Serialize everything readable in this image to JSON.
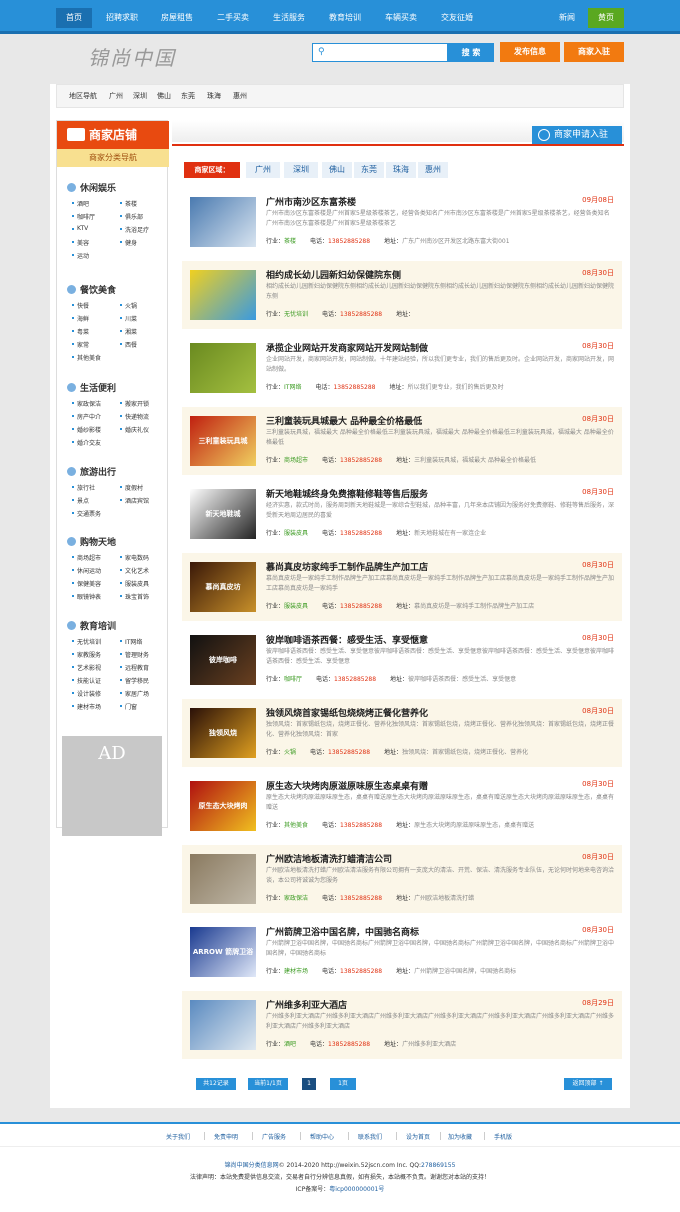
{
  "nav": {
    "items": [
      "首页",
      "招聘求职",
      "房屋租售",
      "二手买卖",
      "生活服务",
      "教育培训",
      "车辆买卖",
      "交友征婚"
    ],
    "right": [
      "新闻",
      "黄页"
    ]
  },
  "header": {
    "logo": "锦尚中国",
    "search_placeholder": "",
    "search_btn": "搜 索",
    "publish": "发布信息",
    "merchant_join": "商家入驻"
  },
  "region_nav": {
    "label": "地区导航",
    "cities": [
      "广州",
      "深圳",
      "佛山",
      "东莞",
      "珠海",
      "惠州"
    ]
  },
  "sidebar": {
    "title": "商家店铺",
    "subtitle": "商家分类导航",
    "ad": "AD",
    "cats": [
      {
        "name": "休闲娱乐",
        "subs": [
          "酒吧",
          "茶楼",
          "咖啡厅",
          "俱乐部",
          "KTV",
          "洗浴足疗",
          "美容",
          "健身",
          "运动"
        ]
      },
      {
        "name": "餐饮美食",
        "subs": [
          "快餐",
          "火锅",
          "海鲜",
          "川菜",
          "粤菜",
          "湘菜",
          "家常",
          "西餐",
          "其他美食"
        ]
      },
      {
        "name": "生活便利",
        "subs": [
          "家政保洁",
          "搬家开锁",
          "房产中介",
          "快递物流",
          "婚纱影楼",
          "婚庆礼仪",
          "婚介交友"
        ]
      },
      {
        "name": "旅游出行",
        "subs": [
          "旅行社",
          "度假村",
          "景点",
          "酒店宾馆",
          "交通票务"
        ]
      },
      {
        "name": "购物天地",
        "subs": [
          "商场超市",
          "家电数码",
          "休闲运动",
          "文化艺术",
          "保健美容",
          "服装皮具",
          "眼镜钟表",
          "珠宝首饰"
        ]
      },
      {
        "name": "教育培训",
        "subs": [
          "无忧培训",
          "IT网络",
          "家教服务",
          "管理财务",
          "艺术影视",
          "远程教育",
          "技能认证",
          "留学移民",
          "设计装修",
          "家居广场",
          "建材市场",
          "门窗"
        ]
      }
    ]
  },
  "content": {
    "apply": "商家申请入驻",
    "area_label": "商家区域：",
    "tabs": [
      "广州",
      "深圳",
      "佛山",
      "东莞",
      "珠海",
      "惠州"
    ],
    "labels": {
      "industry": "行业：",
      "phone": "电话：",
      "address": "地址："
    },
    "items": [
      {
        "title": "广州市南沙区东富茶楼",
        "date": "09月08日",
        "desc": "广州市南沙区东富茶楼是广州首家5星级茶楼茶艺，经营各类知名广州市南沙区东富茶楼是广州首家5星级茶楼茶艺，经营各类知名广州市南沙区东富茶楼是广州首家5星级茶楼茶艺",
        "industry": "茶楼",
        "phone": "13852885288",
        "address": "广东广州南沙区开发区北路东富大街001"
      },
      {
        "title": "相约成长幼儿园新妇幼保健院东侧",
        "date": "08月30日",
        "desc": "相约成长幼儿园新妇幼保健院东侧相约成长幼儿园新妇幼保健院东侧相约成长幼儿园新妇幼保健院东侧相约成长幼儿园新妇幼保健院东侧",
        "industry": "无忧培训",
        "phone": "13852885288",
        "address": ""
      },
      {
        "title": "承揽企业网站开发商家网站开发网站制做",
        "date": "08月30日",
        "desc": "企业网站开发，商家网站开发，网站制做。十年建站经验，所以我们更专业，我们的售后更及时。企业网站开发，商家网站开发，网站制做。",
        "industry": "IT网络",
        "phone": "13852885288",
        "address": "所以我们更专业，我们的售后更及时"
      },
      {
        "title": "三利童装玩具城最大 品种最全价格最低",
        "date": "08月30日",
        "desc": "三利童装玩具城，福城最大 品种最全价格最低三利童装玩具城，福城最大 品种最全价格最低三利童装玩具城，福城最大 品种最全价格最低",
        "industry": "商场超市",
        "phone": "13852885288",
        "address": "三利童装玩具城，福城最大 品种最全价格最低"
      },
      {
        "title": "新天地鞋城终身免费擦鞋修鞋等售后服务",
        "date": "08月30日",
        "desc": "经济实惠，款式时尚，服务周到新天地鞋城是一家综合型鞋城，品种丰富，几年来本店铺因为服务好免费擦鞋、修鞋等售后服务，深受新天地周边居民的喜爱",
        "industry": "服装皮具",
        "phone": "13852885288",
        "address": "新天地鞋城在有一家连企业"
      },
      {
        "title": "慕尚真皮坊家纯手工制作品牌生产加工店",
        "date": "08月30日",
        "desc": "慕尚真皮坊是一家纯手工制作品牌生产加工店慕尚真皮坊是一家纯手工制作品牌生产加工店慕尚真皮坊是一家纯手工制作品牌生产加工店慕尚真皮坊是一家纯手",
        "industry": "服装皮具",
        "phone": "13852885288",
        "address": "慕尚真皮坊是一家纯手工制作品牌生产加工店"
      },
      {
        "title": "彼岸咖啡语茶西餐：感受生活、享受惬意",
        "date": "08月30日",
        "desc": "彼岸咖啡语茶西餐：感受生活、享受惬意彼岸咖啡语茶西餐：感受生活、享受惬意彼岸咖啡语茶西餐：感受生活、享受惬意彼岸咖啡语茶西餐：感受生活、享受惬意",
        "industry": "咖啡厅",
        "phone": "13852885288",
        "address": "彼岸咖啡语茶西餐：感受生活、享受惬意"
      },
      {
        "title": "独领风烧首家锡纸包烧烧烤正餐化营养化",
        "date": "08月30日",
        "desc": "独领风烧：首家锡纸包烧，烧烤正餐化、营养化独领风烧：首家锡纸包烧，烧烤正餐化、营养化独领风烧：首家锡纸包烧，烧烤正餐化、营养化独领风烧：首家",
        "industry": "火锅",
        "phone": "13852885288",
        "address": "独领风烧：首家锡纸包烧，烧烤正餐化、营养化"
      },
      {
        "title": "原生态大块烤肉原滋原味原生态桌桌有赠",
        "date": "08月30日",
        "desc": "原生态大块烤肉原滋原味原生态，桌桌有赠送原生态大块烤肉原滋原味原生态，桌桌有赠送原生态大块烤肉原滋原味原生态，桌桌有赠送",
        "industry": "其他美食",
        "phone": "13852885288",
        "address": "原生态大块烤肉原滋原味原生态，桌桌有赠送"
      },
      {
        "title": "广州欧洁地板清洗打蜡清洁公司",
        "date": "08月30日",
        "desc": "广州欧洁地板清洗打蜡广州欧洁清洁服务有限公司拥有一支庞大的清洁、开荒、保洁、清洗服务专业队伍，无论何时何地来电咨询洽谈，本公司将诚诚为您服务",
        "industry": "家政保洁",
        "phone": "13852885288",
        "address": "广州欧洁地板清洗打蜡"
      },
      {
        "title": "广州箭牌卫浴中国名牌，中国驰名商标",
        "date": "08月30日",
        "desc": "广州箭牌卫浴中国名牌，中国驰名商标广州箭牌卫浴中国名牌，中国驰名商标广州箭牌卫浴中国名牌，中国驰名商标广州箭牌卫浴中国名牌，中国驰名商标",
        "industry": "建材市场",
        "phone": "13852885288",
        "address": "广州箭牌卫浴中国名牌，中国驰名商标"
      },
      {
        "title": "广州维多利亚大酒店",
        "date": "08月29日",
        "desc": "广州维多利亚大酒店广州维多利亚大酒店广州维多利亚大酒店广州维多利亚大酒店广州维多利亚大酒店广州维多利亚大酒店广州维多利亚大酒店广州维多利亚大酒店",
        "industry": "酒吧",
        "phone": "13852885288",
        "address": "广州维多利亚大酒店"
      }
    ],
    "thumb_texts": [
      "",
      "",
      "",
      "三利童装玩具城",
      "新天地鞋城",
      "慕尚真皮坊",
      "彼岸咖啡",
      "独领风烧",
      "原生态大块烤肉",
      "",
      "ARROW 箭牌卫浴",
      ""
    ],
    "pager": {
      "total": "共12记录",
      "page": "当前1/1页",
      "current": "1",
      "pages": "1页",
      "top": "返回顶部 ↑"
    }
  },
  "footer": {
    "links": [
      "关于我们",
      "免责申明",
      "广告服务",
      "帮助中心",
      "联系我们",
      "设为首页",
      "加为收藏",
      "手机版"
    ],
    "copy_site": "锦尚中国分类信息网",
    "copy_rest": "© 2014-2020 http://weixin.52jscn.com Inc. QQ:",
    "qq": "278869155",
    "legal": "法律声明：本站免费提供信息交流，交易者自行分辨信息真假，如有损失，本站概不负责。谢谢您对本站的支持！",
    "icp_label": "ICP备案号：",
    "icp": "粤icp000000001号"
  },
  "colors": {
    "primary": "#2890d8",
    "orange": "#f27a10",
    "red": "#e03010",
    "green": "#5aa820"
  }
}
